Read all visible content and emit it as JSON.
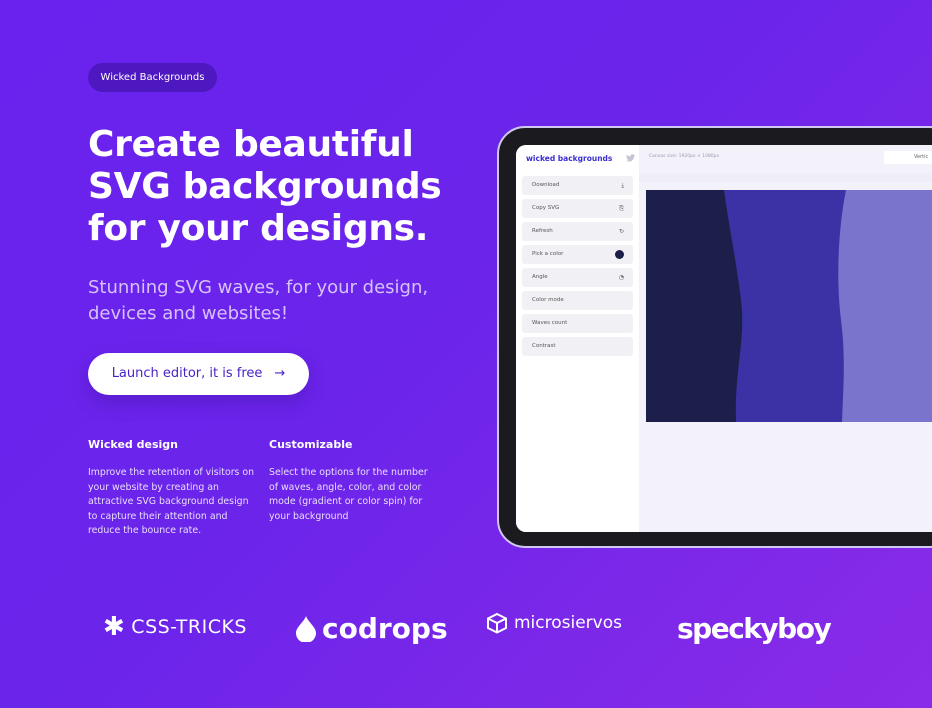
{
  "badge": "Wicked Backgrounds",
  "hero": {
    "title": "Create beautiful SVG backgrounds for your designs.",
    "subtitle": "Stunning SVG waves, for your design, devices and websites!",
    "cta_label": "Launch editor, it is free",
    "cta_arrow": "→"
  },
  "features": [
    {
      "title": "Wicked design",
      "text": "Improve the retention of visitors on your website by creating an attractive SVG background design to capture their attention and reduce the bounce rate."
    },
    {
      "title": "Customizable",
      "text": "Select the options for the number of waves, angle, color, and color mode (gradient or color spin) for your background"
    }
  ],
  "editor": {
    "brand": "wicked backgrounds",
    "twitter_icon": "twitter-icon",
    "canvas_size": "Canvas size: 1920px × 1080px",
    "toggle_label": "Vertic",
    "menu": [
      {
        "label": "Download",
        "icon": "⤓"
      },
      {
        "label": "Copy SVG",
        "icon": "⎘"
      },
      {
        "label": "Refresh",
        "icon": "↻"
      },
      {
        "label": "Pick a color",
        "icon": "color-dot"
      },
      {
        "label": "Angle",
        "icon": "◔"
      },
      {
        "label": "Color mode",
        "icon": ""
      },
      {
        "label": "Waves count",
        "icon": ""
      },
      {
        "label": "Contrast",
        "icon": ""
      }
    ],
    "colors": {
      "wave1": "#1b1f4a",
      "wave2": "#3a32a5",
      "wave3": "#7a74cc",
      "dot": "#1b1f4a"
    }
  },
  "logos": {
    "css_tricks": "CSS-TRICKS",
    "codrops": "codrops",
    "microsiervos": "microsiervos",
    "speckyboy": "speckyboy"
  }
}
